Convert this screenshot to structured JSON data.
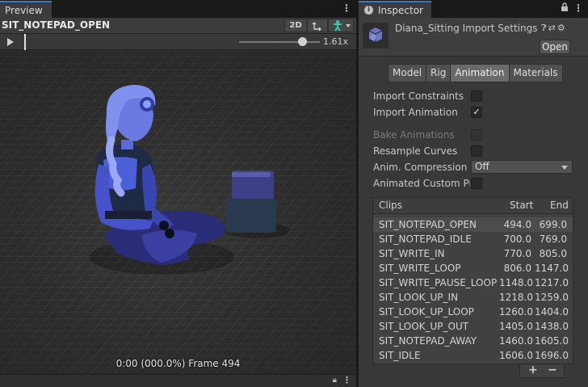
{
  "preview": {
    "tab_label": "Preview",
    "clip_name": "SIT_NOTEPAD_OPEN",
    "btn_2d": "2D",
    "speed": "1.61x",
    "frame_info": "0:00 (000.0%) Frame 494"
  },
  "inspector": {
    "tab_label": "Inspector",
    "asset_title": "Diana_Sitting Import Settings",
    "open_label": "Open",
    "tabs": [
      {
        "label": "Model"
      },
      {
        "label": "Rig"
      },
      {
        "label": "Animation"
      },
      {
        "label": "Materials"
      }
    ],
    "props": {
      "import_constraints": "Import Constraints",
      "import_animation": "Import Animation",
      "bake_animations": "Bake Animations",
      "resample_curves": "Resample Curves",
      "anim_compression": "Anim. Compression",
      "anim_compression_value": "Off",
      "animated_custom_props": "Animated Custom Properties"
    },
    "checks": {
      "import_constraints": false,
      "import_animation": true,
      "bake_animations": false,
      "resample_curves": false,
      "animated_custom_props": false
    },
    "clips_header": {
      "clips": "Clips",
      "start": "Start",
      "end": "End"
    },
    "clips": [
      {
        "name": "SIT_NOTEPAD_OPEN",
        "start": "494.0",
        "end": "699.0"
      },
      {
        "name": "SIT_NOTEPAD_IDLE",
        "start": "700.0",
        "end": "769.0"
      },
      {
        "name": "SIT_WRITE_IN",
        "start": "770.0",
        "end": "805.0"
      },
      {
        "name": "SIT_WRITE_LOOP",
        "start": "806.0",
        "end": "1147.0"
      },
      {
        "name": "SIT_WRITE_PAUSE_LOOP",
        "start": "1148.0",
        "end": "1217.0"
      },
      {
        "name": "SIT_LOOK_UP_IN",
        "start": "1218.0",
        "end": "1259.0"
      },
      {
        "name": "SIT_LOOK_UP_LOOP",
        "start": "1260.0",
        "end": "1404.0"
      },
      {
        "name": "SIT_LOOK_UP_OUT",
        "start": "1405.0",
        "end": "1438.0"
      },
      {
        "name": "SIT_NOTEPAD_AWAY",
        "start": "1460.0",
        "end": "1605.0"
      },
      {
        "name": "SIT_IDLE",
        "start": "1606.0",
        "end": "1696.0"
      }
    ],
    "plus": "+",
    "minus": "−"
  },
  "colors": {
    "accent_tab": "#3a79bb",
    "panel_bg": "#383838",
    "character_blue": "#4a58d8"
  }
}
